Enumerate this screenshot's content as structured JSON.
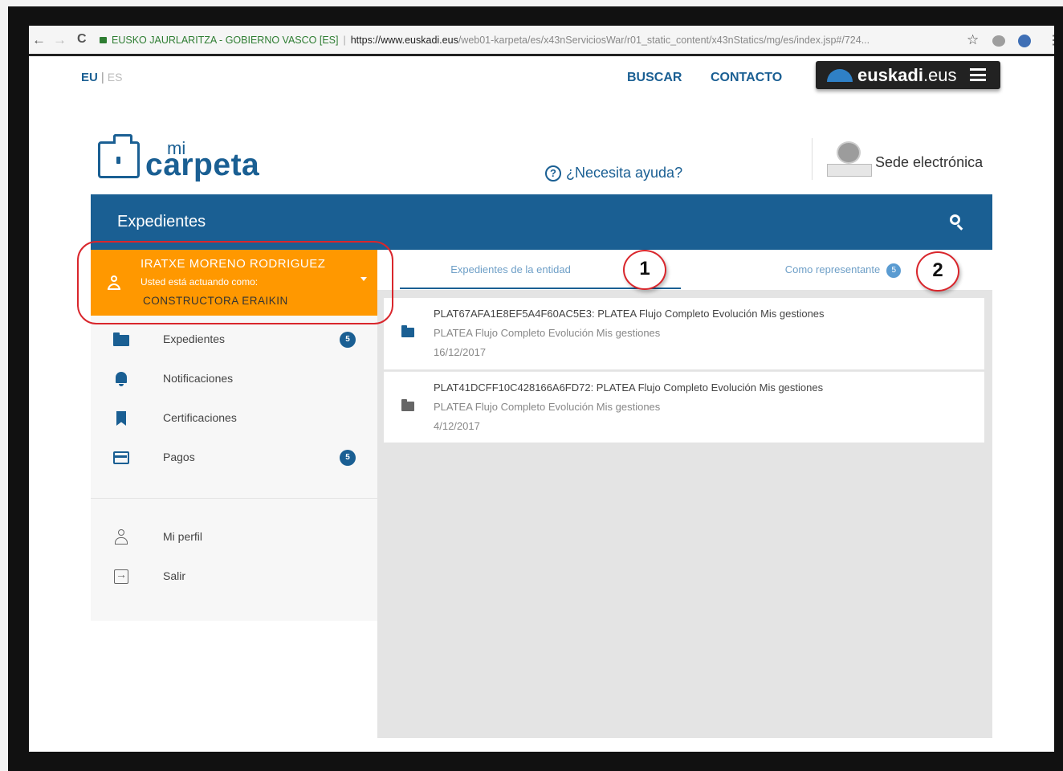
{
  "browser": {
    "back": "←",
    "forward": "→",
    "reload": "C",
    "site_label": "EUSKO JAURLARITZA - GOBIERNO VASCO [ES]",
    "url_host": "https://www.euskadi.eus",
    "url_path": "/web01-karpeta/es/x43nServiciosWar/r01_static_content/x43nStatics/mg/es/index.jsp#/724...",
    "star": "☆",
    "menu": "⋮"
  },
  "topbar": {
    "lang_eu": "EU",
    "lang_sep": "|",
    "lang_es": "ES",
    "buscar": "BUSCAR",
    "contacto": "CONTACTO",
    "euskadi_bold": "euskadi",
    "euskadi_rest": ".eus"
  },
  "header": {
    "logo_mi": "mi",
    "logo_carpeta": "carpeta",
    "help_icon": "?",
    "help": "¿Necesita ayuda?",
    "sede": "Sede electrónica"
  },
  "bluebar": {
    "title": "Expedientes"
  },
  "user": {
    "name": "IRATXE MORENO RODRIGUEZ",
    "acting_as": "Usted está actuando como:",
    "entity": "CONSTRUCTORA ERAIKIN"
  },
  "sidebar": {
    "items": [
      {
        "label": "Expedientes",
        "badge": "5",
        "icon": "folder-icon"
      },
      {
        "label": "Notificaciones",
        "badge": "",
        "icon": "bell-icon"
      },
      {
        "label": "Certificaciones",
        "badge": "",
        "icon": "bookmark-icon"
      },
      {
        "label": "Pagos",
        "badge": "5",
        "icon": "credit-card-icon"
      }
    ],
    "profile": "Mi perfil",
    "logout": "Salir"
  },
  "tabs": {
    "entity": "Expedientes de la entidad",
    "representative": "Como representante",
    "representative_badge": "5"
  },
  "cases": [
    {
      "title": "PLAT67AFA1E8EF5A4F60AC5E3: PLATEA Flujo Completo Evolución Mis gestiones",
      "subtitle": "PLATEA Flujo Completo Evolución Mis gestiones",
      "date": "16/12/2017"
    },
    {
      "title": "PLAT41DCFF10C428166A6FD72: PLATEA Flujo Completo Evolución Mis gestiones",
      "subtitle": "PLATEA Flujo Completo Evolución Mis gestiones",
      "date": "4/12/2017"
    }
  ],
  "annotations": {
    "one": "1",
    "two": "2"
  },
  "colors": {
    "brand_blue": "#1a5f93",
    "orange": "#ff9800",
    "annotation_red": "#d9262c"
  }
}
